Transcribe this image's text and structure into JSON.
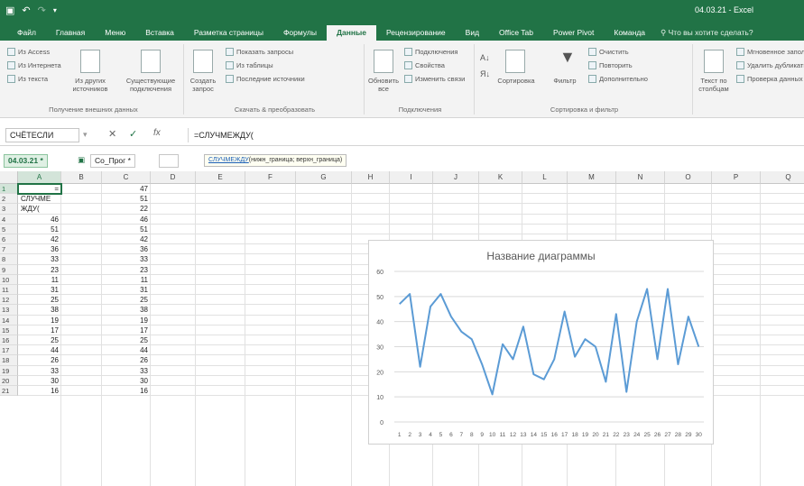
{
  "window": {
    "title": "04.03.21 - Excel",
    "qat": [
      "save-icon",
      "undo-icon",
      "redo-icon",
      "customize-icon"
    ]
  },
  "tabs": [
    "Файл",
    "Главная",
    "Меню",
    "Вставка",
    "Разметка страницы",
    "Формулы",
    "Данные",
    "Рецензирование",
    "Вид",
    "Office Tab",
    "Power Pivot",
    "Команда"
  ],
  "active_tab": "Данные",
  "tell_me": "Что вы хотите сделать?",
  "ribbon": {
    "group1": {
      "items": [
        "Из Access",
        "Из Интернета",
        "Из текста"
      ],
      "big1": "Из других источников",
      "big2": "Существующие подключения",
      "label": "Получение внешних данных"
    },
    "group2": {
      "big": "Создать запрос",
      "items": [
        "Показать запросы",
        "Из таблицы",
        "Последние источники"
      ],
      "label": "Скачать & преобразовать"
    },
    "group3": {
      "big": "Обновить все",
      "items": [
        "Подключения",
        "Свойства",
        "Изменить связи"
      ],
      "label": "Подключения"
    },
    "group4": {
      "sort": "Сортировка",
      "filter": "Фильтр",
      "items": [
        "Очистить",
        "Повторить",
        "Дополнительно"
      ],
      "label": "Сортировка и фильтр"
    },
    "group5": {
      "big": "Текст по столбцам",
      "items": [
        "Мгновенное заполнение",
        "Удалить дубликаты",
        "Проверка данных"
      ]
    }
  },
  "formula_bar": {
    "name_box": "СЧЁТЕСЛИ",
    "cancel": "✕",
    "enter": "✓",
    "fx": "fx",
    "formula": "=СЛУЧМЕЖДУ("
  },
  "sheet_tabs": [
    "04.03.21 *",
    "Со_Прог *"
  ],
  "tooltip": {
    "fn": "СЛУЧМЕЖДУ",
    "args": "(нижн_граница; верхн_граница)"
  },
  "columns": [
    "A",
    "B",
    "C",
    "D",
    "E",
    "F",
    "G",
    "H",
    "I",
    "J",
    "K",
    "L",
    "M",
    "N",
    "O",
    "P",
    "Q"
  ],
  "rows": [
    "1",
    "2",
    "3",
    "4",
    "5",
    "6",
    "7",
    "8",
    "9",
    "10",
    "11",
    "12",
    "13",
    "14",
    "15",
    "16",
    "17",
    "18",
    "19",
    "20",
    "21"
  ],
  "col_a": [
    "=",
    "СЛУЧМЕ",
    "ЖДУ(",
    "46",
    "51",
    "42",
    "36",
    "33",
    "23",
    "11",
    "31",
    "25",
    "38",
    "19",
    "17",
    "25",
    "44",
    "26",
    "33",
    "30",
    "16"
  ],
  "col_c": [
    "47",
    "51",
    "22",
    "46",
    "51",
    "42",
    "36",
    "33",
    "23",
    "11",
    "31",
    "25",
    "38",
    "19",
    "17",
    "25",
    "44",
    "26",
    "33",
    "30",
    "16"
  ],
  "chart_data": {
    "type": "line",
    "title": "Название диаграммы",
    "x": [
      "1",
      "2",
      "3",
      "4",
      "5",
      "6",
      "7",
      "8",
      "9",
      "10",
      "11",
      "12",
      "13",
      "14",
      "15",
      "16",
      "17",
      "18",
      "19",
      "20",
      "21",
      "22",
      "23",
      "24",
      "25",
      "26",
      "27",
      "28",
      "29",
      "30"
    ],
    "series": [
      {
        "values": [
          47,
          51,
          22,
          46,
          51,
          42,
          36,
          33,
          23,
          11,
          31,
          25,
          38,
          19,
          17,
          25,
          44,
          26,
          33,
          30,
          16,
          43,
          12,
          40,
          53,
          25,
          53,
          23,
          42,
          30
        ],
        "color": "#5b9bd5"
      }
    ],
    "yticks": [
      "0",
      "10",
      "20",
      "30",
      "40",
      "50",
      "60"
    ],
    "ylim": [
      0,
      60
    ],
    "grid": true
  }
}
